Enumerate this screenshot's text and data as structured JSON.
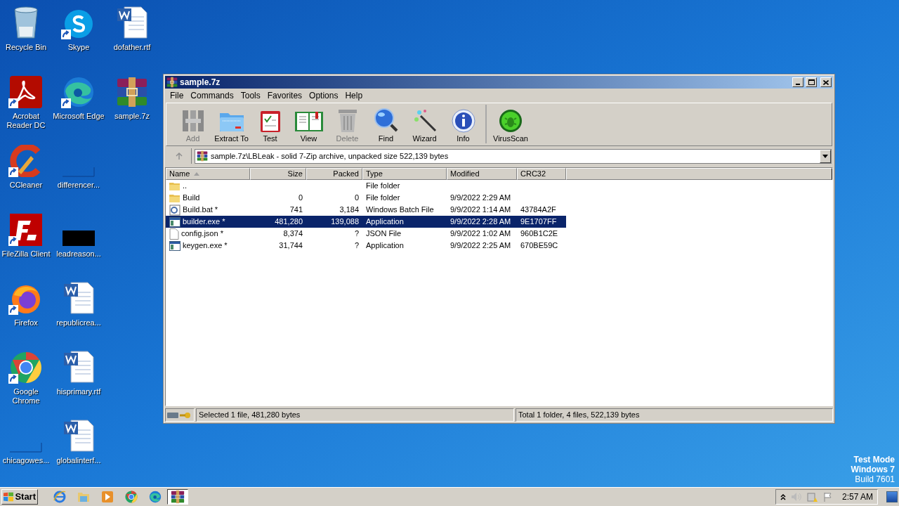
{
  "desktop_icons": [
    {
      "label": "Recycle Bin",
      "kind": "recycle",
      "shortcut": false
    },
    {
      "label": "Acrobat Reader DC",
      "kind": "acrobat",
      "shortcut": true
    },
    {
      "label": "CCleaner",
      "kind": "ccleaner",
      "shortcut": true
    },
    {
      "label": "FileZilla Client",
      "kind": "filezilla",
      "shortcut": true
    },
    {
      "label": "Firefox",
      "kind": "firefox",
      "shortcut": true
    },
    {
      "label": "Google Chrome",
      "kind": "chrome",
      "shortcut": true
    },
    {
      "label": "chicagowes...",
      "kind": "blank",
      "shortcut": false
    },
    {
      "label": "Skype",
      "kind": "skype",
      "shortcut": true
    },
    {
      "label": "Microsoft Edge",
      "kind": "edge",
      "shortcut": true
    },
    {
      "label": "differencer...",
      "kind": "blank",
      "shortcut": false
    },
    {
      "label": "leadreason...",
      "kind": "dark",
      "shortcut": false
    },
    {
      "label": "republicrea...",
      "kind": "word",
      "shortcut": false
    },
    {
      "label": "hisprimary.rtf",
      "kind": "word",
      "shortcut": false
    },
    {
      "label": "globalinterf...",
      "kind": "word",
      "shortcut": false
    },
    {
      "label": "dofather.rtf",
      "kind": "word",
      "shortcut": false
    },
    {
      "label": "sample.7z",
      "kind": "winrar",
      "shortcut": false
    }
  ],
  "window": {
    "title": "sample.7z",
    "menu": [
      "File",
      "Commands",
      "Tools",
      "Favorites",
      "Options",
      "Help"
    ],
    "toolbar": [
      {
        "label": "Add",
        "kind": "add",
        "disabled": true,
        "separated": false
      },
      {
        "label": "Extract To",
        "kind": "extract",
        "disabled": false,
        "separated": false
      },
      {
        "label": "Test",
        "kind": "test",
        "disabled": false,
        "separated": false
      },
      {
        "label": "View",
        "kind": "view",
        "disabled": false,
        "separated": false
      },
      {
        "label": "Delete",
        "kind": "delete",
        "disabled": true,
        "separated": false
      },
      {
        "label": "Find",
        "kind": "find",
        "disabled": false,
        "separated": false
      },
      {
        "label": "Wizard",
        "kind": "wizard",
        "disabled": false,
        "separated": false
      },
      {
        "label": "Info",
        "kind": "info",
        "disabled": false,
        "separated": false
      },
      {
        "label": "VirusScan",
        "kind": "scan",
        "disabled": false,
        "separated": true
      }
    ],
    "address": "sample.7z\\LBLeak - solid 7-Zip archive, unpacked size 522,139 bytes",
    "columns": [
      {
        "label": "Name",
        "sorted": true
      },
      {
        "label": "Size",
        "sorted": false
      },
      {
        "label": "Packed",
        "sorted": false
      },
      {
        "label": "Type",
        "sorted": false
      },
      {
        "label": "Modified",
        "sorted": false
      },
      {
        "label": "CRC32",
        "sorted": false
      }
    ],
    "rows": [
      {
        "kind": "folder",
        "name": "..",
        "size": "",
        "packed": "",
        "type": "File folder",
        "modified": "",
        "crc": "",
        "selected": false
      },
      {
        "kind": "folder",
        "name": "Build",
        "size": "0",
        "packed": "0",
        "type": "File folder",
        "modified": "9/9/2022 2:29 AM",
        "crc": "",
        "selected": false
      },
      {
        "kind": "bat",
        "name": "Build.bat *",
        "size": "741",
        "packed": "3,184",
        "type": "Windows Batch File",
        "modified": "9/9/2022 1:14 AM",
        "crc": "43784A2F",
        "selected": false
      },
      {
        "kind": "exe",
        "name": "builder.exe *",
        "size": "481,280",
        "packed": "139,088",
        "type": "Application",
        "modified": "9/9/2022 2:28 AM",
        "crc": "9E1707FF",
        "selected": true
      },
      {
        "kind": "file",
        "name": "config.json *",
        "size": "8,374",
        "packed": "?",
        "type": "JSON File",
        "modified": "9/9/2022 1:02 AM",
        "crc": "960B1C2E",
        "selected": false
      },
      {
        "kind": "exe",
        "name": "keygen.exe *",
        "size": "31,744",
        "packed": "?",
        "type": "Application",
        "modified": "9/9/2022 2:25 AM",
        "crc": "670BE59C",
        "selected": false
      }
    ],
    "status_left": "Selected 1 file, 481,280 bytes",
    "status_right": "Total 1 folder, 4 files, 522,139 bytes"
  },
  "watermark_os": [
    "Test Mode",
    "Windows 7",
    "Build 7601"
  ],
  "taskbar": {
    "start": "Start",
    "quick_launch": [
      {
        "kind": "ie",
        "active": false
      },
      {
        "kind": "explorer",
        "active": false
      },
      {
        "kind": "media",
        "active": false
      },
      {
        "kind": "chrome",
        "active": false
      },
      {
        "kind": "edge",
        "active": false
      },
      {
        "kind": "winrar",
        "active": true
      }
    ],
    "clock": "2:57 AM"
  }
}
